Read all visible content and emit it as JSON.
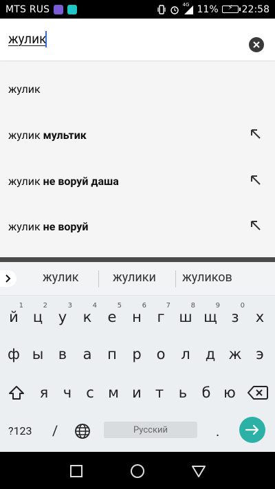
{
  "status_bar": {
    "carrier": "MTS RUS",
    "network_label": "4G",
    "battery_percent": "11%",
    "time": "22:58"
  },
  "search": {
    "query": "жулик"
  },
  "suggestions": [
    {
      "base": "жулик",
      "rest": ""
    },
    {
      "base": "жулик",
      "rest": "мультик"
    },
    {
      "base": "жулик",
      "rest": "не воруй даша"
    },
    {
      "base": "жулик",
      "rest": "не воруй"
    }
  ],
  "keyboard": {
    "candidates": [
      "жулик",
      "жулики",
      "жуликов"
    ],
    "row1": [
      {
        "k": "й",
        "n": "1"
      },
      {
        "k": "ц",
        "n": "2"
      },
      {
        "k": "у",
        "n": "3"
      },
      {
        "k": "к",
        "n": "4"
      },
      {
        "k": "е",
        "n": "5"
      },
      {
        "k": "н",
        "n": "6"
      },
      {
        "k": "г",
        "n": "7"
      },
      {
        "k": "ш",
        "n": "8"
      },
      {
        "k": "щ",
        "n": "9"
      },
      {
        "k": "з",
        "n": "0"
      },
      {
        "k": "х",
        "n": ""
      }
    ],
    "row2": [
      "ф",
      "ы",
      "в",
      "а",
      "п",
      "р",
      "о",
      "л",
      "д",
      "ж",
      "э"
    ],
    "row3": [
      "я",
      "ч",
      "с",
      "м",
      "и",
      "т",
      "ь",
      "б",
      "ю"
    ],
    "symbols_label": "?123",
    "slash_label": "/",
    "space_label": "Русский",
    "period_label": ".",
    "enter_color": "#2bb1a5"
  },
  "colors": {
    "accent": "#2bb1a5",
    "caret": "#2f6fe0"
  }
}
